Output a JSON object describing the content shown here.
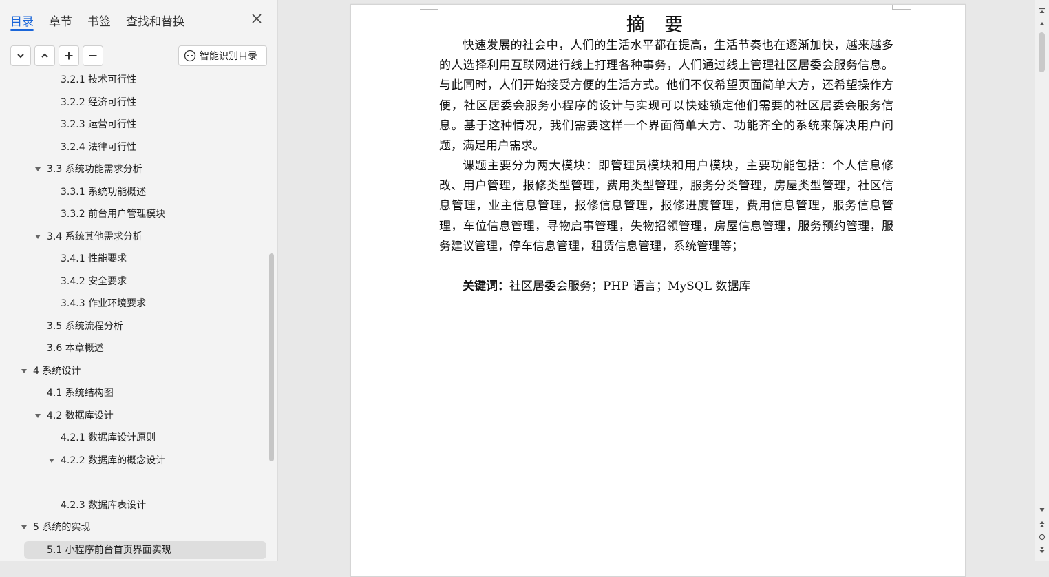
{
  "nav": {
    "tabs": [
      {
        "label": "目录",
        "active": true
      },
      {
        "label": "章节",
        "active": false
      },
      {
        "label": "书签",
        "active": false
      },
      {
        "label": "查找和替换",
        "active": false
      }
    ],
    "smart_toc_label": "智能识别目录",
    "toc": [
      {
        "label": "3.2.1 技术可行性",
        "level": 3,
        "expanded": null,
        "selected": false
      },
      {
        "label": "3.2.2 经济可行性",
        "level": 3,
        "expanded": null,
        "selected": false
      },
      {
        "label": "3.2.3 运营可行性",
        "level": 3,
        "expanded": null,
        "selected": false
      },
      {
        "label": "3.2.4 法律可行性",
        "level": 3,
        "expanded": null,
        "selected": false
      },
      {
        "label": "3.3 系统功能需求分析",
        "level": 2,
        "expanded": true,
        "selected": false
      },
      {
        "label": "3.3.1 系统功能概述",
        "level": 3,
        "expanded": null,
        "selected": false
      },
      {
        "label": "3.3.2 前台用户管理模块",
        "level": 3,
        "expanded": null,
        "selected": false
      },
      {
        "label": "3.4 系统其他需求分析",
        "level": 2,
        "expanded": true,
        "selected": false
      },
      {
        "label": "3.4.1 性能要求",
        "level": 3,
        "expanded": null,
        "selected": false
      },
      {
        "label": "3.4.2 安全要求",
        "level": 3,
        "expanded": null,
        "selected": false
      },
      {
        "label": "3.4.3 作业环境要求",
        "level": 3,
        "expanded": null,
        "selected": false
      },
      {
        "label": "3.5 系统流程分析",
        "level": 2,
        "expanded": null,
        "selected": false
      },
      {
        "label": "3.6 本章概述",
        "level": 2,
        "expanded": null,
        "selected": false
      },
      {
        "label": "4  系统设计",
        "level": 1,
        "expanded": true,
        "selected": false
      },
      {
        "label": "4.1 系统结构图",
        "level": 2,
        "expanded": null,
        "selected": false
      },
      {
        "label": "4.2 数据库设计",
        "level": 2,
        "expanded": true,
        "selected": false
      },
      {
        "label": "4.2.1 数据库设计原则",
        "level": 3,
        "expanded": null,
        "selected": false
      },
      {
        "label": "4.2.2 数据库的概念设计",
        "level": 3,
        "expanded": true,
        "selected": false
      },
      {
        "label": "",
        "level": 4,
        "expanded": null,
        "selected": false
      },
      {
        "label": "4.2.3 数据库表设计",
        "level": 3,
        "expanded": null,
        "selected": false
      },
      {
        "label": "5 系统的实现",
        "level": 1,
        "expanded": true,
        "selected": false
      },
      {
        "label": "5.1 小程序前台首页界面实现",
        "level": 2,
        "expanded": null,
        "selected": true
      }
    ]
  },
  "document": {
    "title": "摘  要",
    "paragraphs": [
      "快速发展的社会中，人们的生活水平都在提高，生活节奏也在逐渐加快，越来越多的人选择利用互联网进行线上打理各种事务，人们通过线上管理社区居委会服务信息。与此同时，人们开始接受方便的生活方式。他们不仅希望页面简单大方，还希望操作方便，社区居委会服务小程序的设计与实现可以快速锁定他们需要的社区居委会服务信息。基于这种情况，我们需要这样一个界面简单大方、功能齐全的系统来解决用户问题，满足用户需求。",
      "课题主要分为两大模块：即管理员模块和用户模块，主要功能包括：个人信息修改、用户管理，报修类型管理，费用类型管理，服务分类管理，房屋类型管理，社区信息管理，业主信息管理，报修信息管理，报修进度管理，费用信息管理，服务信息管理，车位信息管理，寻物启事管理，失物招领管理，房屋信息管理，服务预约管理，服务建议管理，停车信息管理，租赁信息管理，系统管理等；"
    ],
    "keywords_label": "关键词：",
    "keywords": "社区居委会服务；PHP 语言；MySQL 数据库"
  }
}
